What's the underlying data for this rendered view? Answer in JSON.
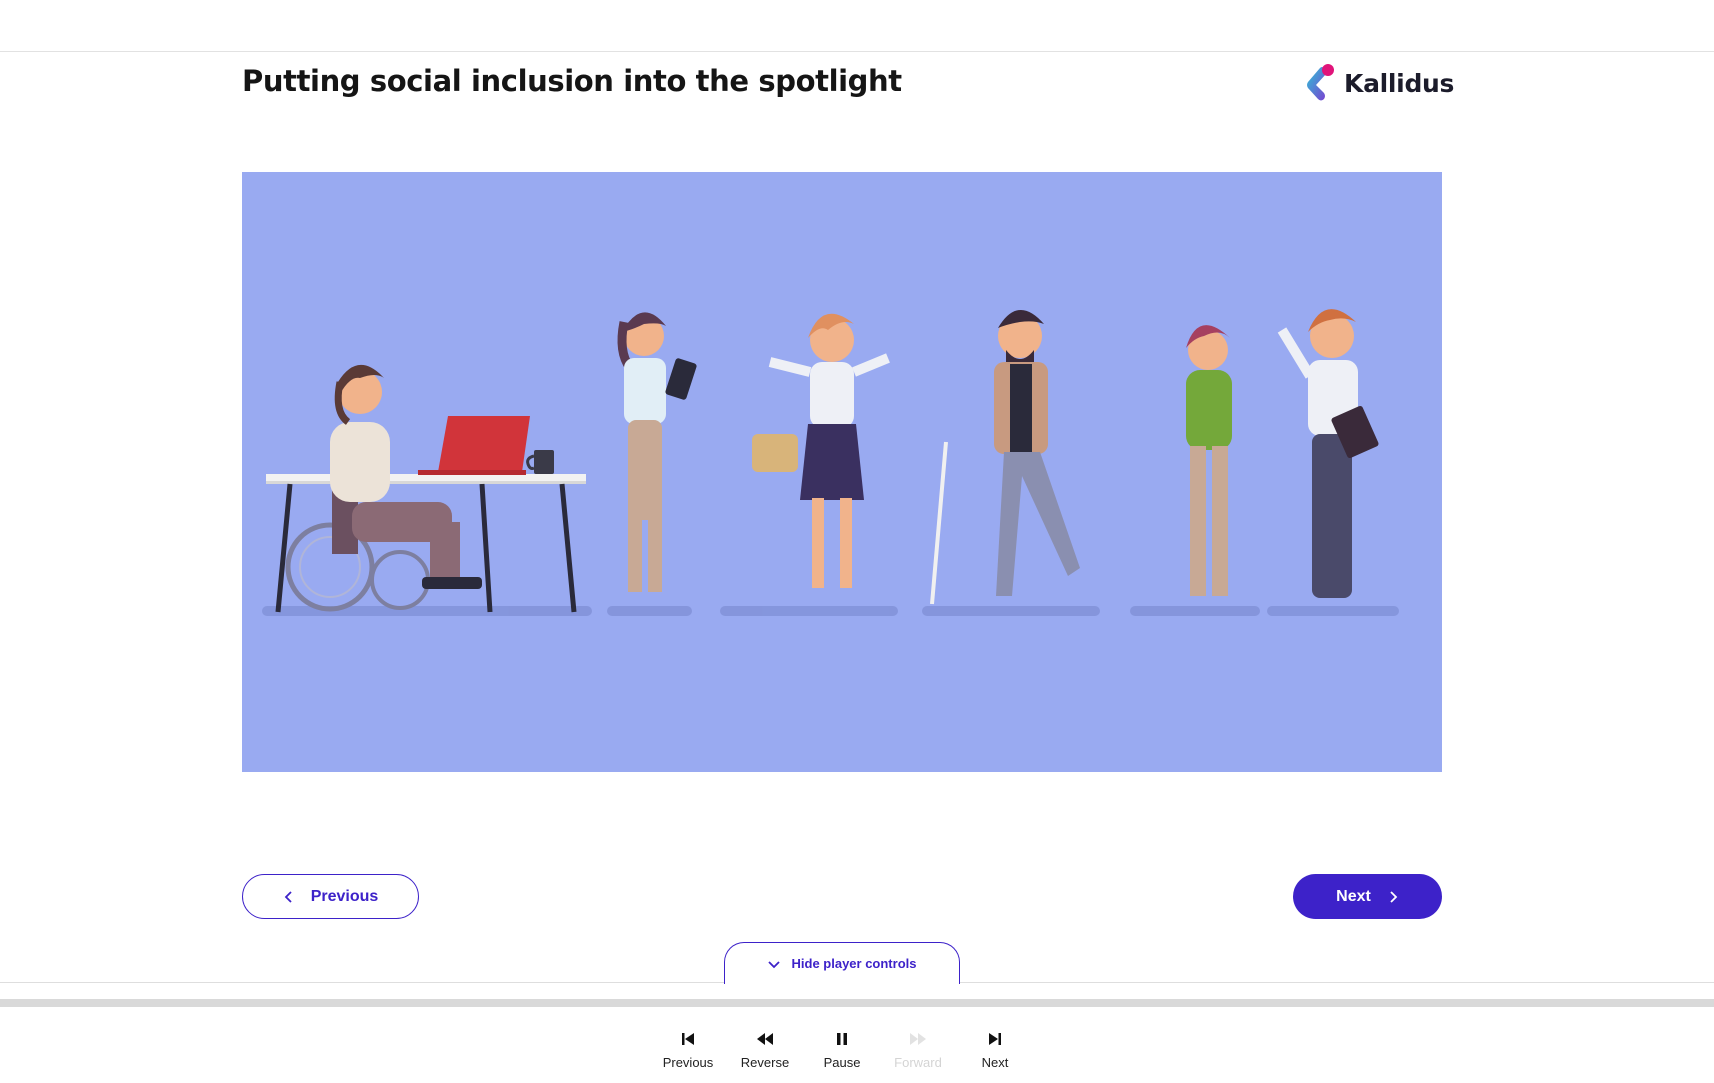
{
  "page": {
    "title": "Putting social inclusion into the spotlight",
    "brand": "Kallidus"
  },
  "illustration": {
    "description_icon": "diverse-people-illustration",
    "background": "#99aaf1"
  },
  "navigation": {
    "previous_label": "Previous",
    "next_label": "Next",
    "accent": "#3d22c9"
  },
  "player": {
    "toggle_label": "Hide player controls",
    "controls": [
      {
        "label": "Previous",
        "icon": "skip-back-icon",
        "enabled": true
      },
      {
        "label": "Reverse",
        "icon": "rewind-icon",
        "enabled": true
      },
      {
        "label": "Pause",
        "icon": "pause-icon",
        "enabled": true
      },
      {
        "label": "Forward",
        "icon": "fast-forward-icon",
        "enabled": false
      },
      {
        "label": "Next",
        "icon": "skip-forward-icon",
        "enabled": true
      }
    ]
  }
}
